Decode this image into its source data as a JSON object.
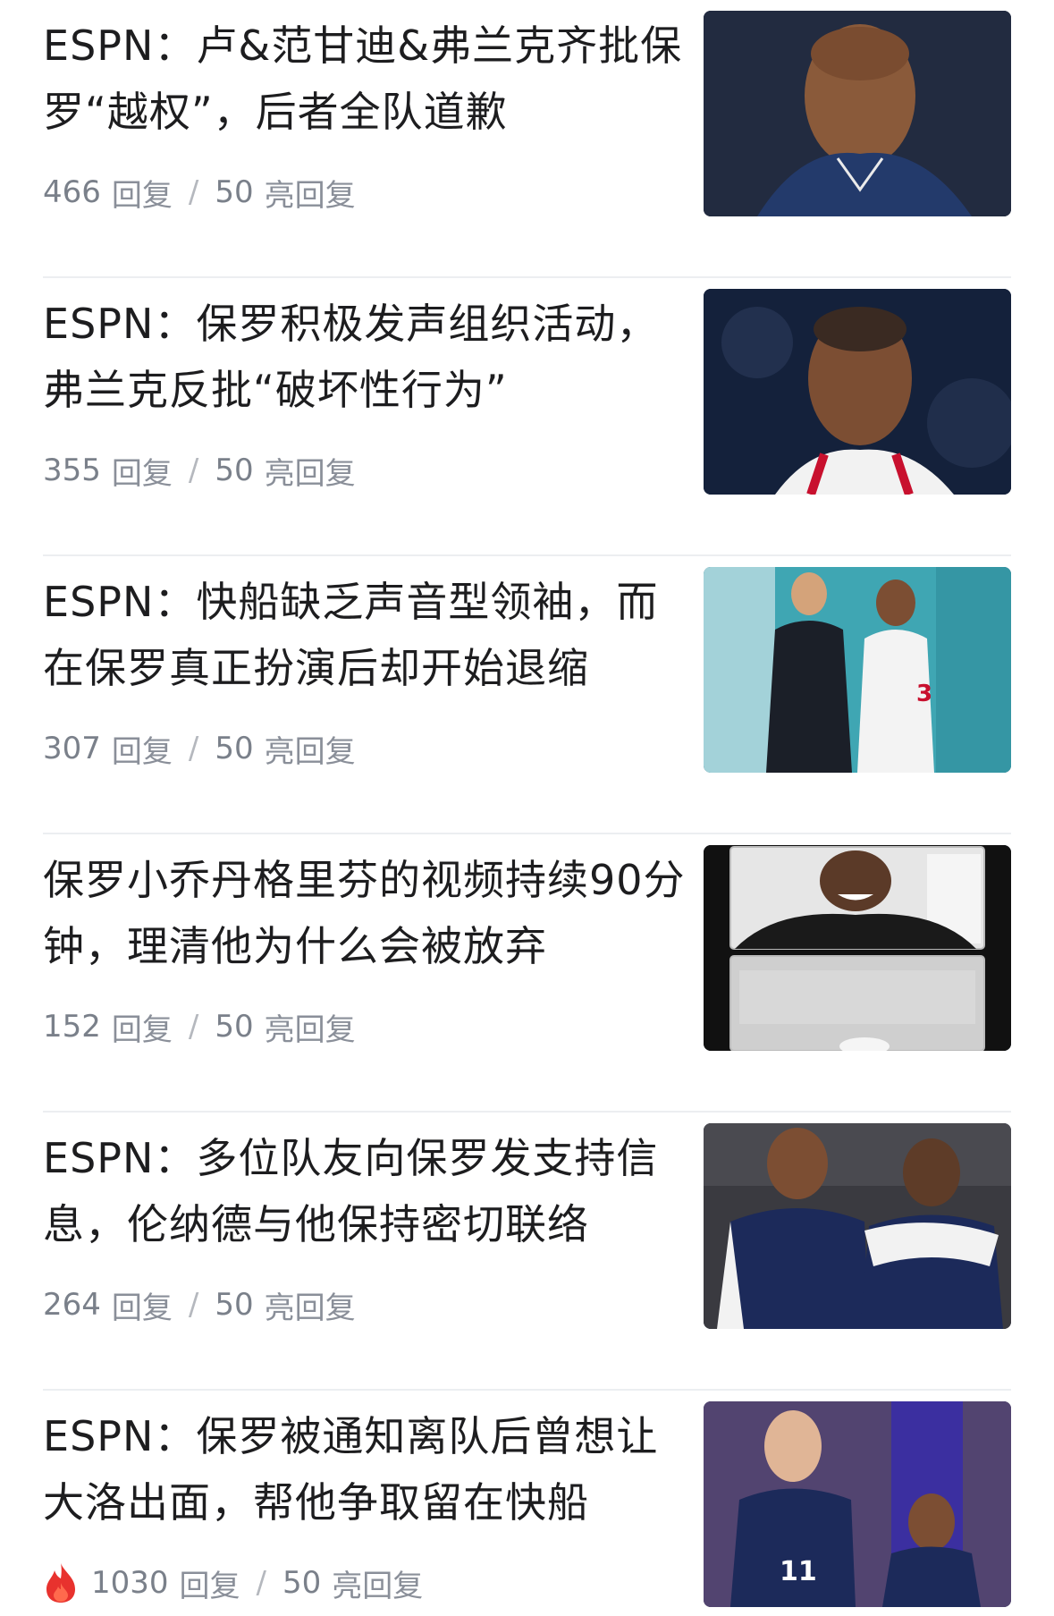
{
  "feed": {
    "items": [
      {
        "title": "ESPN：卢&范甘迪&弗兰克齐批保罗“越权”，后者全队道歉",
        "replies": "466",
        "reply_label": "回复",
        "separator": "/",
        "lights": "50",
        "light_label": "亮回复",
        "hot": false,
        "thumb": {
          "bg": "#1b2438",
          "accent": "#233a6b"
        }
      },
      {
        "title": "ESPN：保罗积极发声组织活动，弗兰克反批“破坏性行为”",
        "replies": "355",
        "reply_label": "回复",
        "separator": "/",
        "lights": "50",
        "light_label": "亮回复",
        "hot": false,
        "thumb": {
          "bg": "#14213b",
          "accent": "#c8102e"
        }
      },
      {
        "title": "ESPN：快船缺乏声音型领袖，而在保罗真正扮演后却开始退缩",
        "replies": "307",
        "reply_label": "回复",
        "separator": "/",
        "lights": "50",
        "light_label": "亮回复",
        "hot": false,
        "thumb": {
          "bg": "#3fa6b3",
          "accent": "#f2f2f2"
        }
      },
      {
        "title": "保罗小乔丹格里芬的视频持续90分钟，理清他为什么会被放弃",
        "replies": "152",
        "reply_label": "回复",
        "separator": "/",
        "lights": "50",
        "light_label": "亮回复",
        "hot": false,
        "thumb": {
          "bg": "#111111",
          "accent": "#d9d9d9"
        }
      },
      {
        "title": "ESPN：多位队友向保罗发支持信息，伦纳德与他保持密切联络",
        "replies": "264",
        "reply_label": "回复",
        "separator": "/",
        "lights": "50",
        "light_label": "亮回复",
        "hot": false,
        "thumb": {
          "bg": "#3a3a40",
          "accent": "#1c2a5a"
        }
      },
      {
        "title": "ESPN：保罗被通知离队后曾想让大洛出面，帮他争取留在快船",
        "replies": "1030",
        "reply_label": "回复",
        "separator": "/",
        "lights": "50",
        "light_label": "亮回复",
        "hot": true,
        "thumb": {
          "bg": "#5b4a7a",
          "accent": "#1c2a5a"
        }
      }
    ]
  },
  "colors": {
    "title": "#1d1d1f",
    "meta": "#8a8f99",
    "divider": "#eceef1",
    "hot_fire": "#e8322e"
  },
  "icons": {
    "hot": "fire-icon"
  }
}
